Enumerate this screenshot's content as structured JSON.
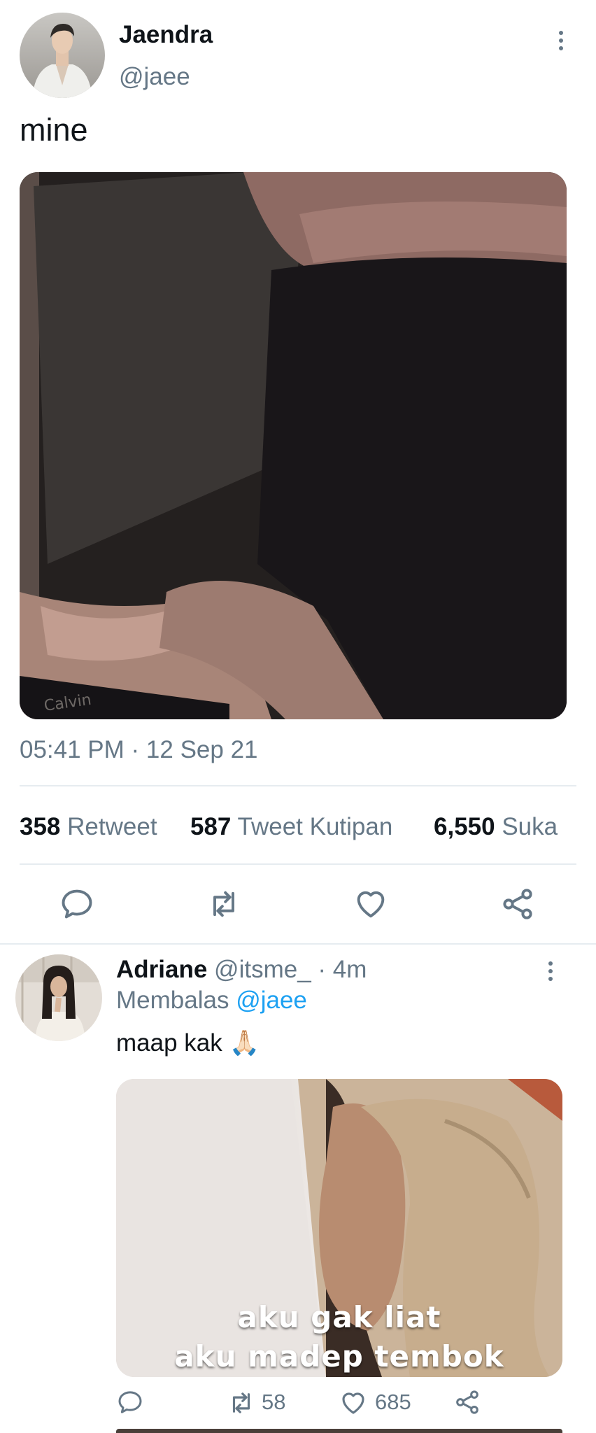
{
  "main_tweet": {
    "author_name": "Jaendra",
    "author_handle": "@jaee",
    "text": "mine",
    "timestamp": "05:41 PM · 12 Sep 21",
    "stats": {
      "retweets_count": "358",
      "retweets_label": "Retweet",
      "quotes_count": "587",
      "quotes_label": "Tweet Kutipan",
      "likes_count": "6,550",
      "likes_label": "Suka"
    }
  },
  "reply": {
    "author_name": "Adriane",
    "author_handle": "@itsme_",
    "time": "· 4m",
    "replying_prefix": "Membalas",
    "replying_to": "@jaee",
    "text": "maap kak",
    "emoji": "🙏🏻",
    "media_caption_line1": "aku gak liat",
    "media_caption_line2": "aku madep tembok",
    "retweet_count": "58",
    "like_count": "685"
  },
  "icons": {
    "reply": "reply-icon",
    "retweet": "retweet-icon",
    "like": "heart-icon",
    "share": "share-icon",
    "more": "more-icon"
  },
  "colors": {
    "link": "#1da1f2",
    "muted": "#657786",
    "divider": "#e6ecf0"
  }
}
